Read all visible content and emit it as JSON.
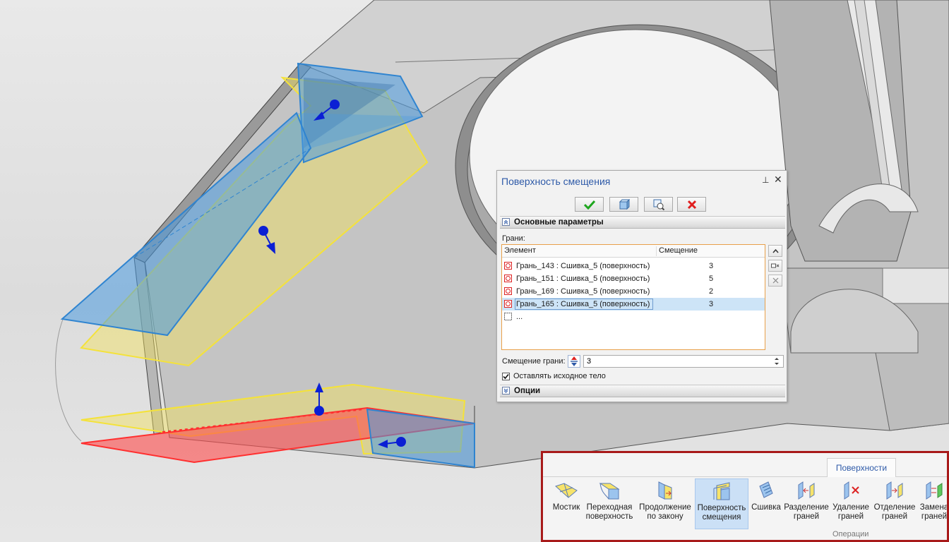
{
  "dialog": {
    "title": "Поверхность смещения",
    "pin_glyph": "⊥",
    "close_glyph": "✕",
    "buttons": [
      {
        "name": "ok-button",
        "icon": "green-check-icon"
      },
      {
        "name": "preview-button",
        "icon": "preview-icon"
      },
      {
        "name": "zoom-preview-button",
        "icon": "zoom-preview-icon"
      },
      {
        "name": "cancel-button",
        "icon": "red-x-icon"
      }
    ],
    "main_section": "Основные параметры",
    "faces_label": "Грани:",
    "table": {
      "col_element": "Элемент",
      "col_offset": "Смещение",
      "rows": [
        {
          "name": "Грань_143 : Сшивка_5 (поверхность)",
          "offset": "3"
        },
        {
          "name": "Грань_151 : Сшивка_5 (поверхность)",
          "offset": "5"
        },
        {
          "name": "Грань_169 : Сшивка_5 (поверхность)",
          "offset": "2"
        },
        {
          "name": "Грань_165 : Сшивка_5 (поверхность)",
          "offset": "3",
          "selected": true
        }
      ],
      "new_row": "..."
    },
    "offset_label": "Смещение грани:",
    "offset_value": "3",
    "keep_body_label": "Оставлять исходное тело",
    "keep_body_checked": true,
    "options_section": "Опции"
  },
  "ribbon": {
    "tab": "Поверхности",
    "group": "Операции",
    "buttons": [
      {
        "line1": "Мостик",
        "line2": "",
        "icon": "bridge-icon"
      },
      {
        "line1": "Переходная",
        "line2": "поверхность",
        "icon": "transition-surface-icon"
      },
      {
        "line1": "Продолжение",
        "line2": "по закону",
        "icon": "extend-by-law-icon"
      },
      {
        "line1": "Поверхность",
        "line2": "смещения",
        "icon": "offset-surface-icon",
        "active": true
      },
      {
        "line1": "Сшивка",
        "line2": "",
        "icon": "stitch-icon"
      },
      {
        "line1": "Разделение",
        "line2": "граней",
        "icon": "split-faces-icon"
      },
      {
        "line1": "Удаление",
        "line2": "граней",
        "icon": "delete-faces-icon"
      },
      {
        "line1": "Отделение",
        "line2": "граней",
        "icon": "detach-faces-icon"
      },
      {
        "line1": "Замена",
        "line2": "граней",
        "icon": "replace-faces-icon"
      }
    ]
  },
  "colors": {
    "accent_blue": "#2e5aa8",
    "selected_row": "#cde4f7",
    "ribbon_frame": "#a81a1a",
    "face_blue": "#4a9be0",
    "face_yellow": "#f3e25a",
    "face_red": "#ff4b4b"
  }
}
